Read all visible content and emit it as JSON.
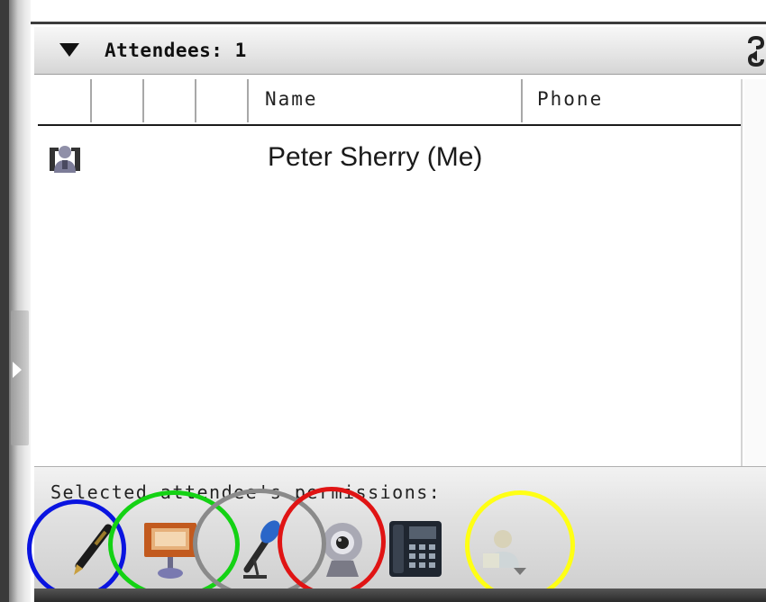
{
  "panel": {
    "title": "Attendees: 1",
    "refresh_icon": "refresh-icon"
  },
  "columns": [
    "",
    "",
    "",
    "",
    "Name",
    "Phone"
  ],
  "attendees": [
    {
      "icon": "presenter-avatar-icon",
      "name": "Peter Sherry (Me)",
      "phone": ""
    }
  ],
  "permissions": {
    "label": "Selected attendee's permissions:",
    "tools": [
      {
        "icon": "pen-annotate-icon"
      },
      {
        "icon": "presentation-board-icon"
      },
      {
        "icon": "microphone-icon"
      },
      {
        "icon": "webcam-icon"
      },
      {
        "icon": "phone-icon"
      },
      {
        "icon": "attendee-menu-icon"
      }
    ]
  },
  "annotation_colors": {
    "blue": "#0a14e0",
    "green": "#14d214",
    "gray": "#8a8a8a",
    "red": "#e01414",
    "yellow": "#ffff14"
  }
}
